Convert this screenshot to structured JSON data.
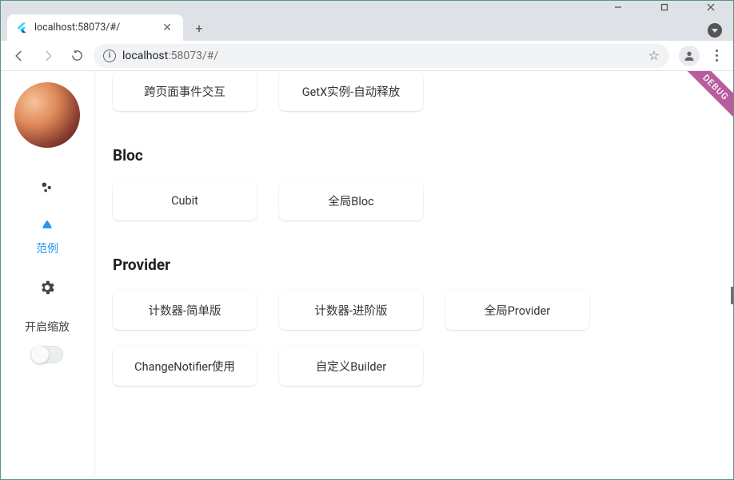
{
  "window": {
    "tab_title": "localhost:58073/#/",
    "url_host": "localhost",
    "url_portpath": ":58073/#/"
  },
  "debug_ribbon": "DEBUG",
  "sidebar": {
    "items": [
      {
        "label": ""
      },
      {
        "label": "范例"
      },
      {
        "label": ""
      }
    ],
    "toggle_label": "开启缩放"
  },
  "top_row": {
    "cards": [
      "跨页面事件交互",
      "GetX实例-自动释放"
    ]
  },
  "sections": [
    {
      "title": "Bloc",
      "rows": [
        [
          "Cubit",
          "全局Bloc"
        ]
      ]
    },
    {
      "title": "Provider",
      "rows": [
        [
          "计数器-简单版",
          "计数器-进阶版",
          "全局Provider"
        ],
        [
          "ChangeNotifier使用",
          "自定义Builder"
        ]
      ]
    }
  ]
}
